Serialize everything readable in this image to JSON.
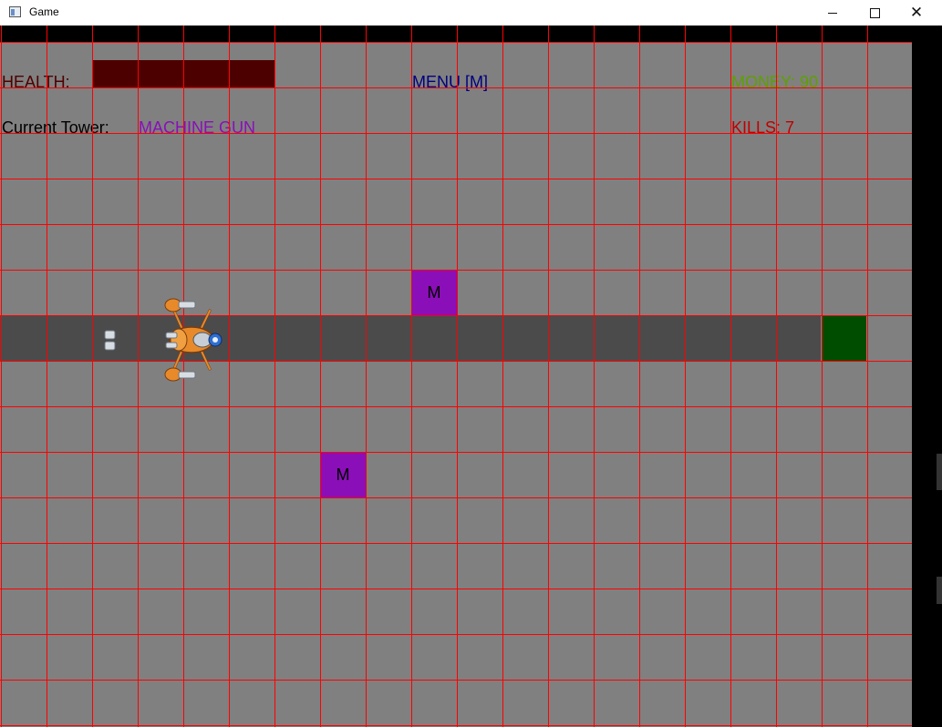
{
  "window": {
    "title": "Game"
  },
  "hud": {
    "health_label": "HEALTH:",
    "menu_label": "MENU [M]",
    "money_label": "MONEY: 90",
    "current_tower_label": "Current Tower:",
    "current_tower_value": "MACHINE GUN",
    "kills_label": "KILLS: 7"
  },
  "health": {
    "fraction": 1.0,
    "color": "#4d0000"
  },
  "towers": [
    {
      "label": "M",
      "col": 9,
      "row": 5
    },
    {
      "label": "M",
      "col": 7,
      "row": 9
    }
  ],
  "path": {
    "row": 6,
    "from_col": 0,
    "to_col": 17
  },
  "goal": {
    "col": 18,
    "row": 6
  },
  "colors": {
    "background": "#808080",
    "grid": "#ff0000",
    "path": "#4b4b4b",
    "goal": "#004d00",
    "tower": "#8a0fb8",
    "money": "#5ea000",
    "menu": "#00007f",
    "kills": "#c00000"
  },
  "icons": {
    "enemy": "orange-spider-robot-icon",
    "bullet": "bullet-icon"
  }
}
